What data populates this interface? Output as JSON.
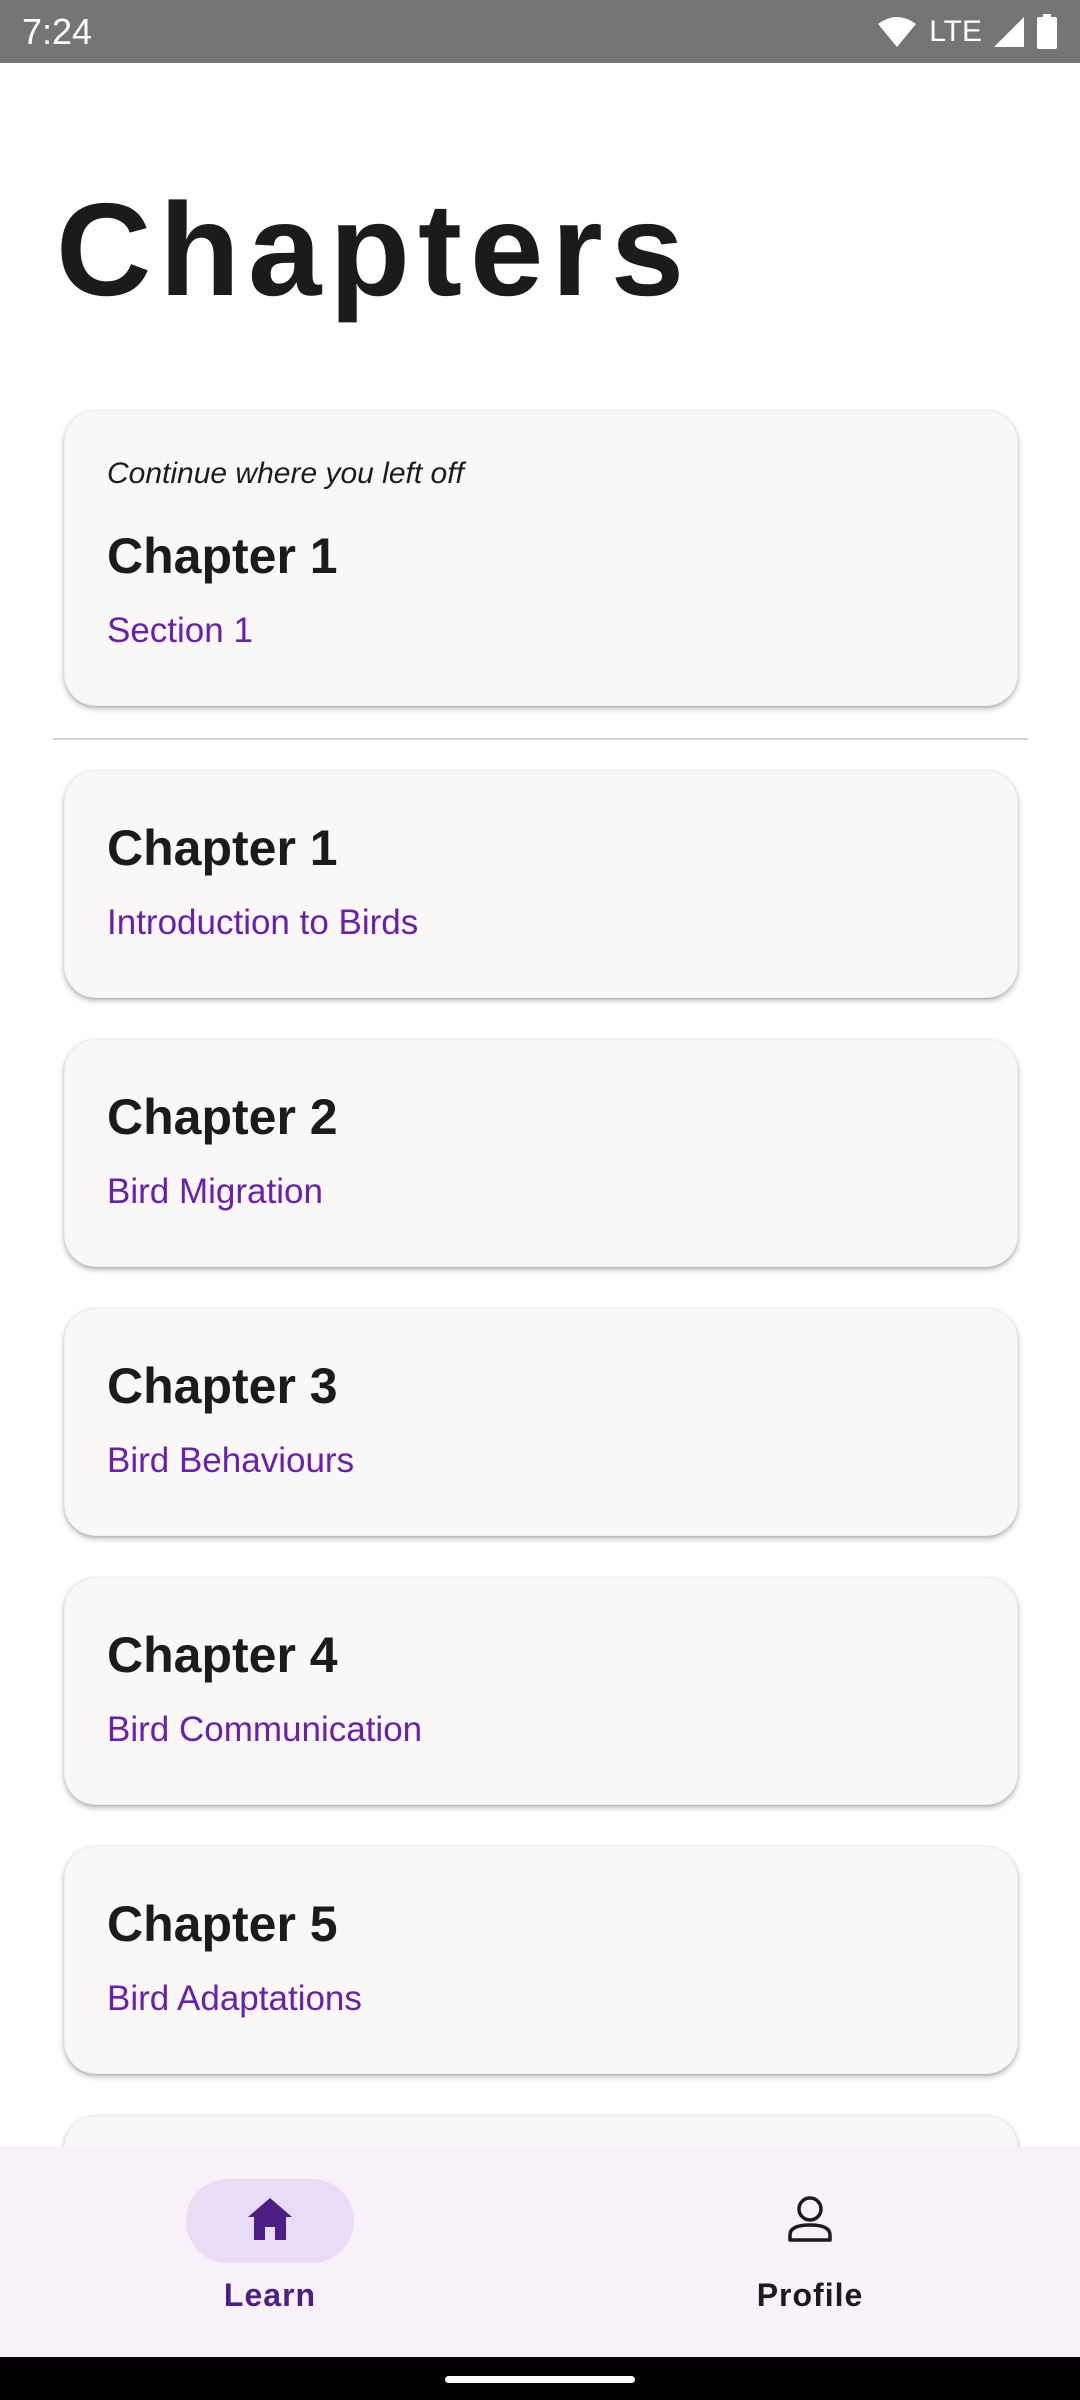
{
  "status_bar": {
    "time": "7:24",
    "network": "LTE",
    "icons": [
      "wifi-icon",
      "cell-signal-icon",
      "battery-icon"
    ]
  },
  "page": {
    "title": "Chapters"
  },
  "continue_card": {
    "caption": "Continue where you left off",
    "title": "Chapter 1",
    "subtitle": "Section 1"
  },
  "chapters": [
    {
      "title": "Chapter 1",
      "subtitle": "Introduction to Birds"
    },
    {
      "title": "Chapter 2",
      "subtitle": "Bird Migration"
    },
    {
      "title": "Chapter 3",
      "subtitle": "Bird Behaviours"
    },
    {
      "title": "Chapter 4",
      "subtitle": "Bird Communication"
    },
    {
      "title": "Chapter 5",
      "subtitle": "Bird Adaptations"
    }
  ],
  "bottom_nav": {
    "items": [
      {
        "label": "Learn",
        "icon": "home-icon",
        "selected": true
      },
      {
        "label": "Profile",
        "icon": "person-icon",
        "selected": false
      }
    ]
  },
  "colors": {
    "accent": "#6a1fb0",
    "status_bar": "#757575",
    "card_bg": "#f9f8f7",
    "nav_bg": "#f8f1fa",
    "nav_pill": "#e8dcf7"
  }
}
